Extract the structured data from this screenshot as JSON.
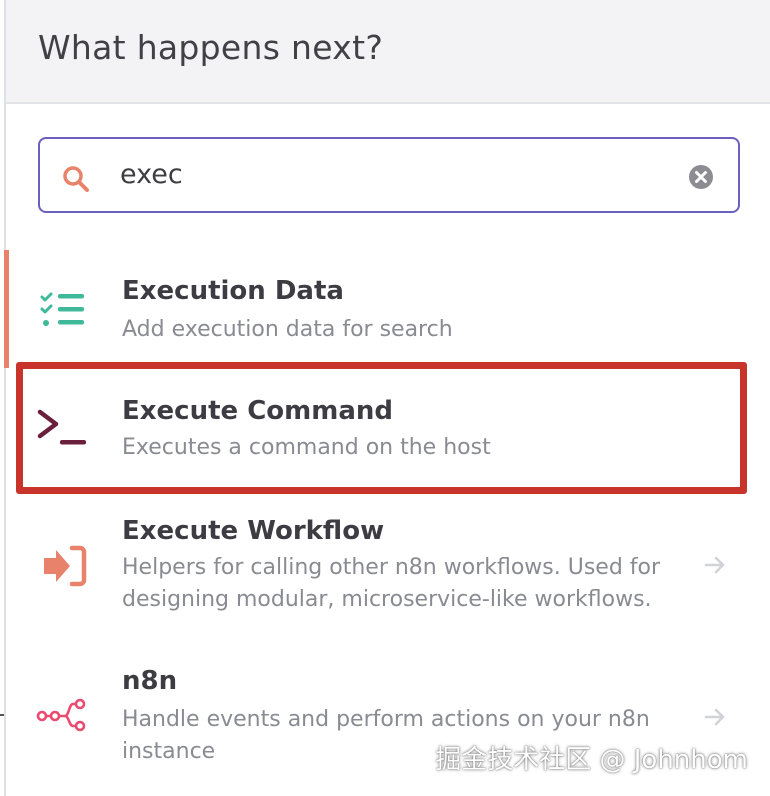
{
  "header": {
    "title": "What happens next?"
  },
  "search": {
    "value": "exec"
  },
  "items": [
    {
      "title": "Execution Data",
      "desc": "Add execution data for search",
      "icon": "list-check-icon",
      "color": "#3fb99a"
    },
    {
      "title": "Execute Command",
      "desc": "Executes a command on the host",
      "icon": "terminal-icon",
      "color": "#6a1f3d"
    },
    {
      "title": "Execute Workflow",
      "desc": "Helpers for calling other n8n workflows. Used for designing modular, microservice-like workflows.",
      "icon": "sign-in-icon",
      "color": "#e8826a"
    },
    {
      "title": "n8n",
      "desc": "Handle events and perform actions on your n8n instance",
      "icon": "n8n-logo-icon",
      "color": "#ea4b71"
    }
  ],
  "colors": {
    "accent": "#6b5fbf",
    "highlight": "#c8342a",
    "active_bar": "#e8826a"
  },
  "watermark": "掘金技术社区 @ Johnhom"
}
